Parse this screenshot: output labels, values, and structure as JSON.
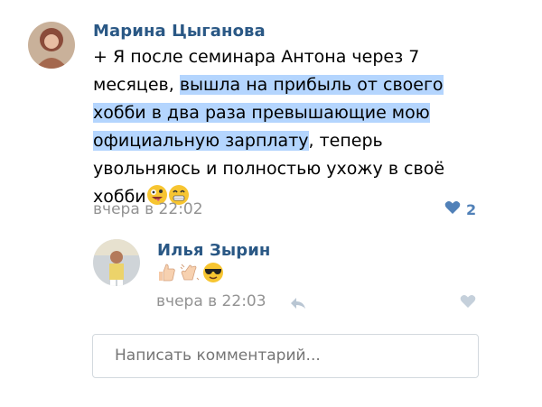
{
  "comment": {
    "author": "Марина Цыганова",
    "text_line1": "+ Я после семинара Антона через 7",
    "text_line2_plain": "месяцев, ",
    "text_line2_hl": "вышла на прибыль от своего",
    "text_line3_hl": "хобби в два раза превышающие мою",
    "text_line4_hl": "официальную зарплату",
    "text_line4_plain": ", теперь",
    "text_line5": "увольняюсь и полностью ухожу в своё",
    "text_line6": "хобби",
    "time": "вчера в 22:02",
    "like_count": "2"
  },
  "reply": {
    "author": "Илья Зырин",
    "time": "вчера в 22:03"
  },
  "composer": {
    "placeholder": "Написать комментарий..."
  },
  "colors": {
    "name": "#2a5885",
    "highlight": "#b4d5fe",
    "meta": "#939393",
    "like_active": "#5181b8",
    "like_inactive": "#c5d0db"
  }
}
